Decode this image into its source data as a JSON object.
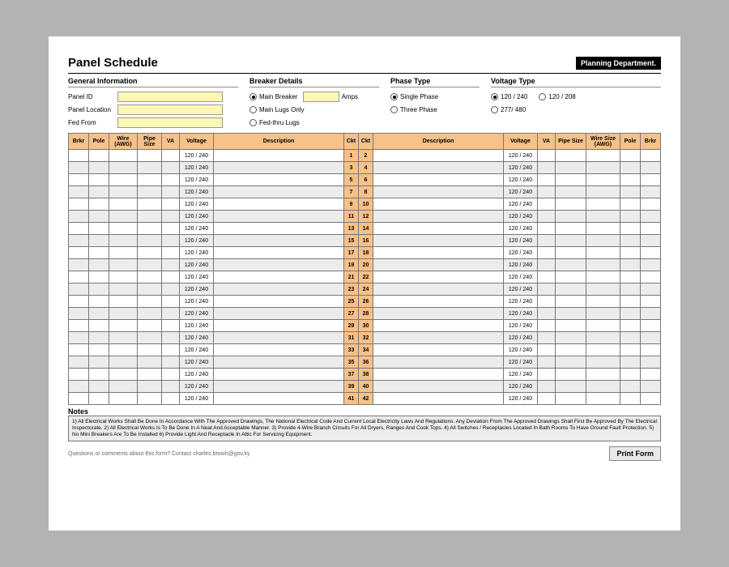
{
  "title": "Panel Schedule",
  "dept_badge": "Planning Department.",
  "sections": {
    "general": {
      "title": "General Information",
      "fields": {
        "panel_id_label": "Panel ID",
        "panel_id_value": "",
        "panel_location_label": "Panel Location",
        "panel_location_value": "",
        "fed_from_label": "Fed From",
        "fed_from_value": ""
      }
    },
    "breaker": {
      "title": "Breaker Details",
      "options": {
        "main_breaker": "Main Breaker",
        "main_lugs": "Main Lugs Only",
        "fed_thru": "Fed-thru Lugs"
      },
      "amps_value": "",
      "amps_label": "Amps"
    },
    "phase": {
      "title": "Phase Type",
      "options": {
        "single": "Single Phase",
        "three": "Three Phase"
      }
    },
    "voltage_type": {
      "title": "Voltage Type",
      "options": {
        "v120_240": "120 / 240",
        "v120_208": "120 / 208",
        "v277_480": "277/ 480"
      }
    }
  },
  "table": {
    "headers": {
      "brkr": "Brkr",
      "pole": "Pole",
      "wire": "Wire (AWG)",
      "pipe": "Pipe Size",
      "va": "VA",
      "voltage": "Voltage",
      "description": "Description",
      "ckt": "Ckt",
      "wire_size": "Wire Size (AWG)"
    },
    "voltage_value": "120 / 240",
    "rows": [
      {
        "l": 1,
        "r": 2
      },
      {
        "l": 3,
        "r": 4
      },
      {
        "l": 5,
        "r": 6
      },
      {
        "l": 7,
        "r": 8
      },
      {
        "l": 9,
        "r": 10
      },
      {
        "l": 11,
        "r": 12
      },
      {
        "l": 13,
        "r": 14
      },
      {
        "l": 15,
        "r": 16
      },
      {
        "l": 17,
        "r": 18
      },
      {
        "l": 19,
        "r": 20
      },
      {
        "l": 21,
        "r": 22
      },
      {
        "l": 23,
        "r": 24
      },
      {
        "l": 25,
        "r": 26
      },
      {
        "l": 27,
        "r": 28
      },
      {
        "l": 29,
        "r": 30
      },
      {
        "l": 31,
        "r": 32
      },
      {
        "l": 33,
        "r": 34
      },
      {
        "l": 35,
        "r": 36
      },
      {
        "l": 37,
        "r": 38
      },
      {
        "l": 39,
        "r": 40
      },
      {
        "l": 41,
        "r": 42
      }
    ]
  },
  "notes": {
    "title": "Notes",
    "body": "1) All Electrical Works Shall Be Done In Accordance With The Approved Drawings, The National Electrical Code And Current Local Electricity Laws And Regulations. Any Deviation From The Approved Drawings Shall First Be Approved By The Electrical Inspectorate.  2) All Electrical Works Is To Be Done In A Neat And Acceptable Manner.  3) Provide 4-Wire Branch Circuits For All Dryers, Ranges And Cook Tops.  4) All Switches / Receptacles Located In Bath Rooms To Have Ground Fault Protection.  5) No Mini Breakers Are To Be Installed  6) Provide Light And Receptacle In Attic For Servicing Equipment."
  },
  "footer": {
    "question": "Questions or comments about this form? Contact charles.brown@gov.ky",
    "print": "Print Form"
  }
}
